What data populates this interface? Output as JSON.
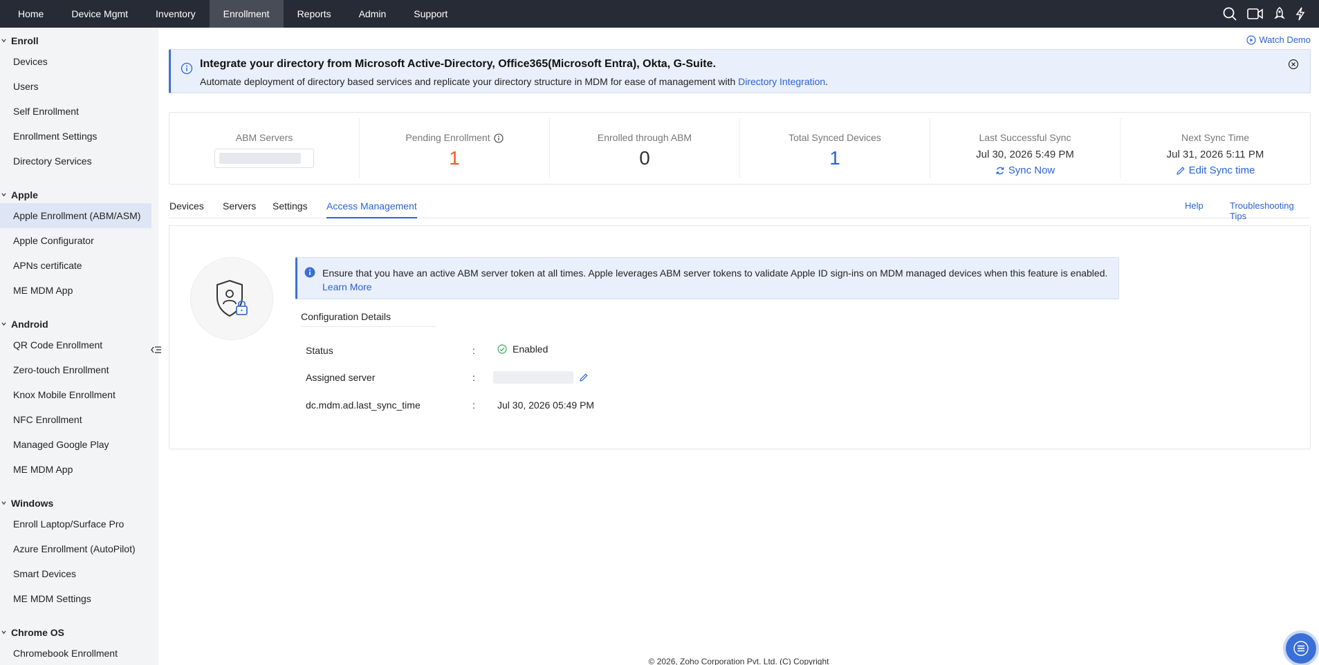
{
  "topnav": {
    "tabs": [
      "Home",
      "Device Mgmt",
      "Inventory",
      "Enrollment",
      "Reports",
      "Admin",
      "Support"
    ],
    "active": "Enrollment",
    "icons": [
      "search-icon",
      "video-icon",
      "rocket-icon",
      "lightning-icon"
    ]
  },
  "sidebar": {
    "groups": [
      {
        "title": "Enroll",
        "items": [
          "Devices",
          "Users",
          "Self Enrollment",
          "Enrollment Settings",
          "Directory Services"
        ]
      },
      {
        "title": "Apple",
        "items": [
          "Apple Enrollment (ABM/ASM)",
          "Apple Configurator",
          "APNs certificate",
          "ME MDM App"
        ]
      },
      {
        "title": "Android",
        "items": [
          "QR Code Enrollment",
          "Zero-touch Enrollment",
          "Knox Mobile Enrollment",
          "NFC Enrollment",
          "Managed Google Play",
          "ME MDM App"
        ]
      },
      {
        "title": "Windows",
        "items": [
          "Enroll Laptop/Surface Pro",
          "Azure Enrollment (AutoPilot)",
          "Smart Devices",
          "ME MDM Settings"
        ]
      },
      {
        "title": "Chrome OS",
        "items": [
          "Chromebook Enrollment"
        ]
      }
    ],
    "active_item": "Apple Enrollment (ABM/ASM)"
  },
  "watch_demo": "Watch Demo",
  "banner": {
    "title": "Integrate your directory from Microsoft Active-Directory, Office365(Microsoft Entra), Okta, G-Suite.",
    "text": "Automate deployment of directory based services and replicate your directory structure in MDM for ease of management with ",
    "link": "Directory Integration",
    "suffix": "."
  },
  "stats": {
    "abm_servers": {
      "label": "ABM Servers"
    },
    "pending": {
      "label": "Pending Enrollment",
      "value": "1"
    },
    "enrolled": {
      "label": "Enrolled through ABM",
      "value": "0"
    },
    "synced": {
      "label": "Total Synced Devices",
      "value": "1"
    },
    "last_sync": {
      "label": "Last Successful Sync",
      "date": "Jul 30, 2026 5:49 PM",
      "link": "Sync Now"
    },
    "next_sync": {
      "label": "Next Sync Time",
      "date": "Jul 31, 2026 5:11 PM",
      "link": "Edit Sync time"
    }
  },
  "subtabs": {
    "items": [
      "Devices",
      "Servers",
      "Settings",
      "Access Management"
    ],
    "active": "Access Management",
    "help": "Help",
    "tips": "Troubleshooting Tips"
  },
  "note": {
    "text": "Ensure that you have an active ABM server token at all times. Apple leverages ABM server tokens to validate Apple ID sign-ins on MDM managed devices when this feature is enabled. ",
    "link": "Learn More"
  },
  "config": {
    "title": "Configuration Details",
    "rows": [
      {
        "label": "Status",
        "value": "Enabled"
      },
      {
        "label": "Assigned server",
        "value": ""
      },
      {
        "label": "dc.mdm.ad.last_sync_time",
        "value": "Jul 30, 2026 05:49 PM"
      }
    ],
    "colon": ":"
  },
  "footer": "© 2026, Zoho Corporation Pvt. Ltd. (C) Copyright",
  "colors": {
    "accent": "#2a62d6",
    "orange": "#f05a28",
    "nav": "#262b35",
    "success": "#3aa35b"
  }
}
